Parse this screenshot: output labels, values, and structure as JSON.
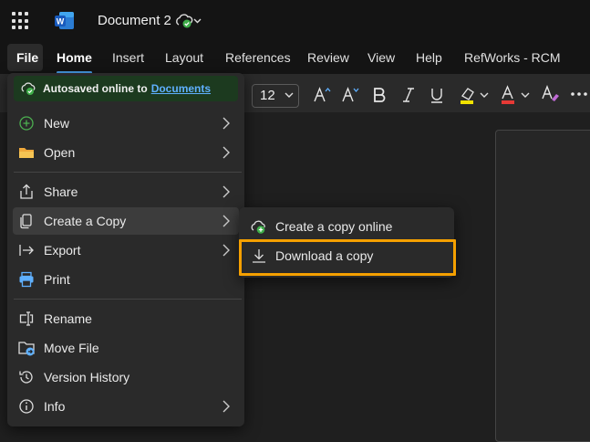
{
  "titlebar": {
    "document_title": "Document 2"
  },
  "ribbon": {
    "tabs": [
      {
        "label": "File"
      },
      {
        "label": "Home"
      },
      {
        "label": "Insert"
      },
      {
        "label": "Layout"
      },
      {
        "label": "References"
      },
      {
        "label": "Review"
      },
      {
        "label": "View"
      },
      {
        "label": "Help"
      },
      {
        "label": "RefWorks - RCM"
      }
    ],
    "font_size": "12"
  },
  "file_menu": {
    "autosave_text": "Autosaved online to",
    "autosave_link": "Documents",
    "items": [
      {
        "label": "New",
        "icon": "plus-circle-icon",
        "has_submenu": true
      },
      {
        "label": "Open",
        "icon": "folder-icon",
        "has_submenu": true
      },
      {
        "label": "Share",
        "icon": "share-icon",
        "has_submenu": true
      },
      {
        "label": "Create a Copy",
        "icon": "copy-icon",
        "has_submenu": true
      },
      {
        "label": "Export",
        "icon": "export-icon",
        "has_submenu": true
      },
      {
        "label": "Print",
        "icon": "printer-icon",
        "has_submenu": false
      },
      {
        "label": "Rename",
        "icon": "rename-icon",
        "has_submenu": false
      },
      {
        "label": "Move File",
        "icon": "move-file-icon",
        "has_submenu": false
      },
      {
        "label": "Version History",
        "icon": "history-icon",
        "has_submenu": false
      },
      {
        "label": "Info",
        "icon": "info-icon",
        "has_submenu": true
      }
    ]
  },
  "copy_submenu": {
    "items": [
      {
        "label": "Create a copy online",
        "icon": "cloud-add-icon"
      },
      {
        "label": "Download a copy",
        "icon": "download-icon"
      }
    ]
  },
  "colors": {
    "accent": "#4aa3f0",
    "highlight": "#f5a000",
    "word_blue": "#185abd"
  }
}
